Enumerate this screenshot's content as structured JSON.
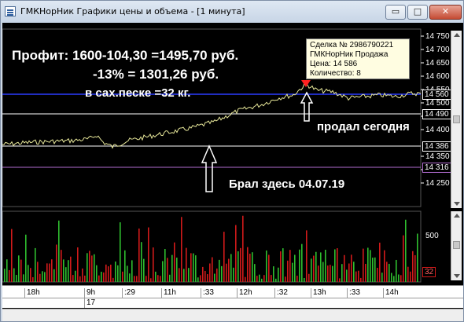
{
  "window": {
    "title": "ГМКНорНик Графики цены и объема - [1 минута]",
    "buttons": {
      "restore": "▭",
      "maximize": "□",
      "close": "✕"
    }
  },
  "annotations": {
    "profit_line": "Профит:  1600-104,30   =1495,70 руб.",
    "percent_line": "-13%            = 1301,26 руб.",
    "sand_line": "в сах.песке  =32 кг.",
    "sold_label": "продал сегодня",
    "bought_label": "Брал здесь 04.07.19"
  },
  "tooltip": {
    "line1": "Сделка № 2986790221",
    "line2": "ГМКНорНик Продажа",
    "line3": "Цена: 14 586",
    "line4": "Количество: 8"
  },
  "price_axis": {
    "ticks": [
      "14 750",
      "14 700",
      "14 650",
      "14 600",
      "14 550",
      "14 500",
      "14 450",
      "14 400",
      "14 350",
      "14 300",
      "14 250"
    ],
    "boxes": [
      "14 560",
      "14 490",
      "14 386",
      "14 316"
    ]
  },
  "volume_axis": {
    "tick": "500",
    "box": "32"
  },
  "time_axis": {
    "labels": [
      "18h",
      "9h",
      ":29",
      "11h",
      ":33",
      "12h",
      ":32",
      "13h",
      ":33",
      "14h"
    ],
    "date": "17"
  },
  "colors": {
    "price_line": "#e8e89a",
    "level_blue": "#2a3cff",
    "level_white": "#ffffff",
    "level_purple": "#b06bd0",
    "vol_green": "#2fbf2f",
    "vol_red": "#d11a1a",
    "marker": "#ff2020"
  }
}
